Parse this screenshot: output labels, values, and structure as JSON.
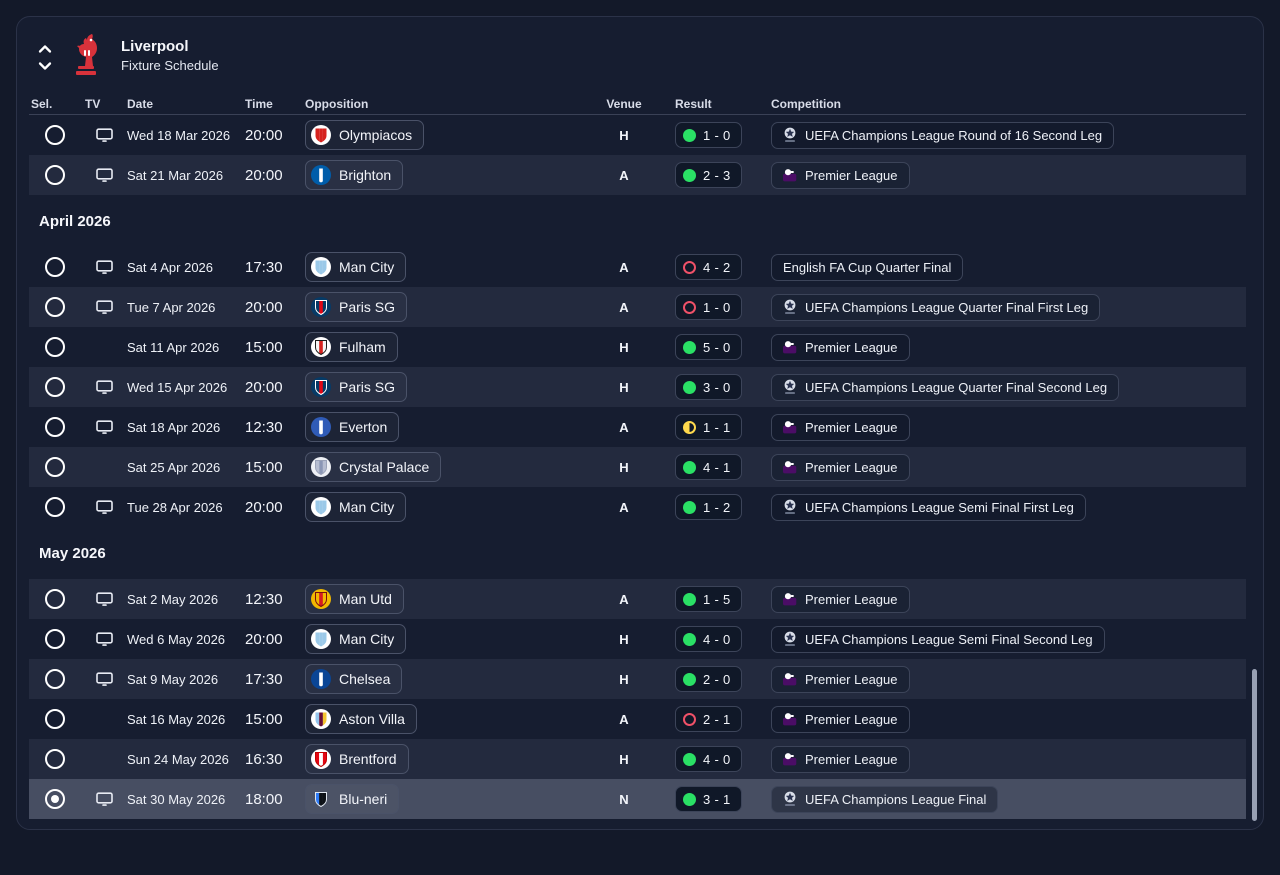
{
  "header": {
    "title": "Liverpool",
    "subtitle": "Fixture Schedule"
  },
  "columns": {
    "sel": "Sel.",
    "tv": "TV",
    "date": "Date",
    "time": "Time",
    "opposition": "Opposition",
    "venue": "Venue",
    "result": "Result",
    "competition": "Competition"
  },
  "colors": {
    "page_bg": "#131929",
    "panel_bg": "#161d30",
    "row_light": "#232a3e",
    "row_selected": "#474e62",
    "win_dot": "#2ae065",
    "loss_ring": "#ef5168",
    "draw_half": "#ffd94d",
    "pill_border": "#3c4459",
    "pl_purple": "#4b0d66",
    "ucl_ball": "#d9dee9"
  },
  "icons": {
    "crest": "liverpool-crest",
    "up": "chevron-up-icon",
    "down": "chevron-down-icon",
    "tv": "tv-icon",
    "ucl": "champions-league-starball-icon",
    "pl": "premier-league-lion-icon"
  },
  "badges": {
    "Olympiacos": {
      "circle": "#ffffff",
      "stripes": [
        "#d6231f",
        "#d6231f",
        "#d6231f"
      ],
      "stroke": "none"
    },
    "Brighton": {
      "circle": "#005daa",
      "stripes": [
        "#005daa",
        "#ffffff",
        "#005daa"
      ],
      "stroke": "none"
    },
    "Man City": {
      "circle": "#ffffff",
      "stripes": [
        "#9bc9e8",
        "#9bc9e8",
        "#9bc9e8"
      ],
      "stroke": "none"
    },
    "Paris SG": {
      "circle": "#063a66",
      "stripes": [
        "#063a66",
        "#e30613",
        "#063a66"
      ],
      "stroke": "#ffffff"
    },
    "Fulham": {
      "circle": "#ffffff",
      "stripes": [
        "#f5f5f5",
        "#d6231f",
        "#f5f5f5"
      ],
      "stroke": "#1d1d1b"
    },
    "Everton": {
      "circle": "#2f5bb7",
      "stripes": [
        "#2f5bb7",
        "#ffffff",
        "#2f5bb7"
      ],
      "stroke": "none"
    },
    "Crystal Palace": {
      "circle": "#eef0f5",
      "stripes": [
        "#b6bdd1",
        "#8a96b5",
        "#b6bdd1"
      ],
      "stroke": "#9aa2b8"
    },
    "Man Utd": {
      "circle": "#f2b800",
      "stripes": [
        "#f2b800",
        "#d81920",
        "#f2b800"
      ],
      "stroke": "#7a0c10"
    },
    "Chelsea": {
      "circle": "#0a4595",
      "stripes": [
        "#0a4595",
        "#ffffff",
        "#0a4595"
      ],
      "stroke": "none"
    },
    "Aston Villa": {
      "circle": "#ffffff",
      "stripes": [
        "#94c5ec",
        "#670e36",
        "#f4c430"
      ],
      "stroke": "none"
    },
    "Brentford": {
      "circle": "#ffffff",
      "stripes": [
        "#e30613",
        "#ffffff",
        "#e30613"
      ],
      "stroke": "#c00000"
    },
    "Blu-neri": {
      "circle": "none",
      "stripes": [
        "#2e7bf6",
        "#0d1117",
        "#0d1117"
      ],
      "stroke": "#dfe5ee"
    }
  },
  "sections": [
    {
      "title": null,
      "rows": [
        {
          "selected": false,
          "tv": true,
          "date": "Wed 18 Mar 2026",
          "time": "20:00",
          "opponent": "Olympiacos",
          "venue": "H",
          "result": {
            "outcome": "win",
            "score": "1 - 0"
          },
          "competition": {
            "icon": "ucl",
            "name": "UEFA Champions League Round of 16  Second Leg"
          }
        },
        {
          "selected": false,
          "tv": true,
          "date": "Sat 21 Mar 2026",
          "time": "20:00",
          "opponent": "Brighton",
          "venue": "A",
          "result": {
            "outcome": "win",
            "score": "2 - 3"
          },
          "competition": {
            "icon": "pl",
            "name": "Premier League"
          }
        }
      ]
    },
    {
      "title": "April 2026",
      "rows": [
        {
          "selected": false,
          "tv": true,
          "date": "Sat 4 Apr 2026",
          "time": "17:30",
          "opponent": "Man City",
          "venue": "A",
          "result": {
            "outcome": "loss",
            "score": "4 - 2"
          },
          "competition": {
            "icon": "none",
            "name": "English FA Cup Quarter Final"
          }
        },
        {
          "selected": false,
          "tv": true,
          "date": "Tue 7 Apr 2026",
          "time": "20:00",
          "opponent": "Paris SG",
          "venue": "A",
          "result": {
            "outcome": "loss",
            "score": "1 - 0"
          },
          "competition": {
            "icon": "ucl",
            "name": "UEFA Champions League Quarter Final First Leg"
          }
        },
        {
          "selected": false,
          "tv": false,
          "date": "Sat 11 Apr 2026",
          "time": "15:00",
          "opponent": "Fulham",
          "venue": "H",
          "result": {
            "outcome": "win",
            "score": "5 - 0"
          },
          "competition": {
            "icon": "pl",
            "name": "Premier League"
          }
        },
        {
          "selected": false,
          "tv": true,
          "date": "Wed 15 Apr 2026",
          "time": "20:00",
          "opponent": "Paris SG",
          "venue": "H",
          "result": {
            "outcome": "win",
            "score": "3 - 0"
          },
          "competition": {
            "icon": "ucl",
            "name": "UEFA Champions League Quarter Final Second Leg"
          }
        },
        {
          "selected": false,
          "tv": true,
          "date": "Sat 18 Apr 2026",
          "time": "12:30",
          "opponent": "Everton",
          "venue": "A",
          "result": {
            "outcome": "draw",
            "score": "1 - 1"
          },
          "competition": {
            "icon": "pl",
            "name": "Premier League"
          }
        },
        {
          "selected": false,
          "tv": false,
          "date": "Sat 25 Apr 2026",
          "time": "15:00",
          "opponent": "Crystal Palace",
          "venue": "H",
          "result": {
            "outcome": "win",
            "score": "4 - 1"
          },
          "competition": {
            "icon": "pl",
            "name": "Premier League"
          }
        },
        {
          "selected": false,
          "tv": true,
          "date": "Tue 28 Apr 2026",
          "time": "20:00",
          "opponent": "Man City",
          "venue": "A",
          "result": {
            "outcome": "win",
            "score": "1 - 2"
          },
          "competition": {
            "icon": "ucl",
            "name": "UEFA Champions League Semi Final First Leg"
          }
        }
      ]
    },
    {
      "title": "May 2026",
      "rows": [
        {
          "selected": false,
          "tv": true,
          "date": "Sat 2 May 2026",
          "time": "12:30",
          "opponent": "Man Utd",
          "venue": "A",
          "result": {
            "outcome": "win",
            "score": "1 - 5"
          },
          "competition": {
            "icon": "pl",
            "name": "Premier League"
          }
        },
        {
          "selected": false,
          "tv": true,
          "date": "Wed 6 May 2026",
          "time": "20:00",
          "opponent": "Man City",
          "venue": "H",
          "result": {
            "outcome": "win",
            "score": "4 - 0"
          },
          "competition": {
            "icon": "ucl",
            "name": "UEFA Champions League Semi Final Second Leg"
          }
        },
        {
          "selected": false,
          "tv": true,
          "date": "Sat 9 May 2026",
          "time": "17:30",
          "opponent": "Chelsea",
          "venue": "H",
          "result": {
            "outcome": "win",
            "score": "2 - 0"
          },
          "competition": {
            "icon": "pl",
            "name": "Premier League"
          }
        },
        {
          "selected": false,
          "tv": false,
          "date": "Sat 16 May 2026",
          "time": "15:00",
          "opponent": "Aston Villa",
          "venue": "A",
          "result": {
            "outcome": "loss",
            "score": "2 - 1"
          },
          "competition": {
            "icon": "pl",
            "name": "Premier League"
          }
        },
        {
          "selected": false,
          "tv": false,
          "date": "Sun 24 May 2026",
          "time": "16:30",
          "opponent": "Brentford",
          "venue": "H",
          "result": {
            "outcome": "win",
            "score": "4 - 0"
          },
          "competition": {
            "icon": "pl",
            "name": "Premier League"
          }
        },
        {
          "selected": true,
          "tv": true,
          "date": "Sat 30 May 2026",
          "time": "18:00",
          "opponent": "Blu-neri",
          "venue": "N",
          "result": {
            "outcome": "win",
            "score": "3 - 1"
          },
          "competition": {
            "icon": "ucl",
            "name": "UEFA Champions League Final"
          }
        }
      ]
    }
  ]
}
